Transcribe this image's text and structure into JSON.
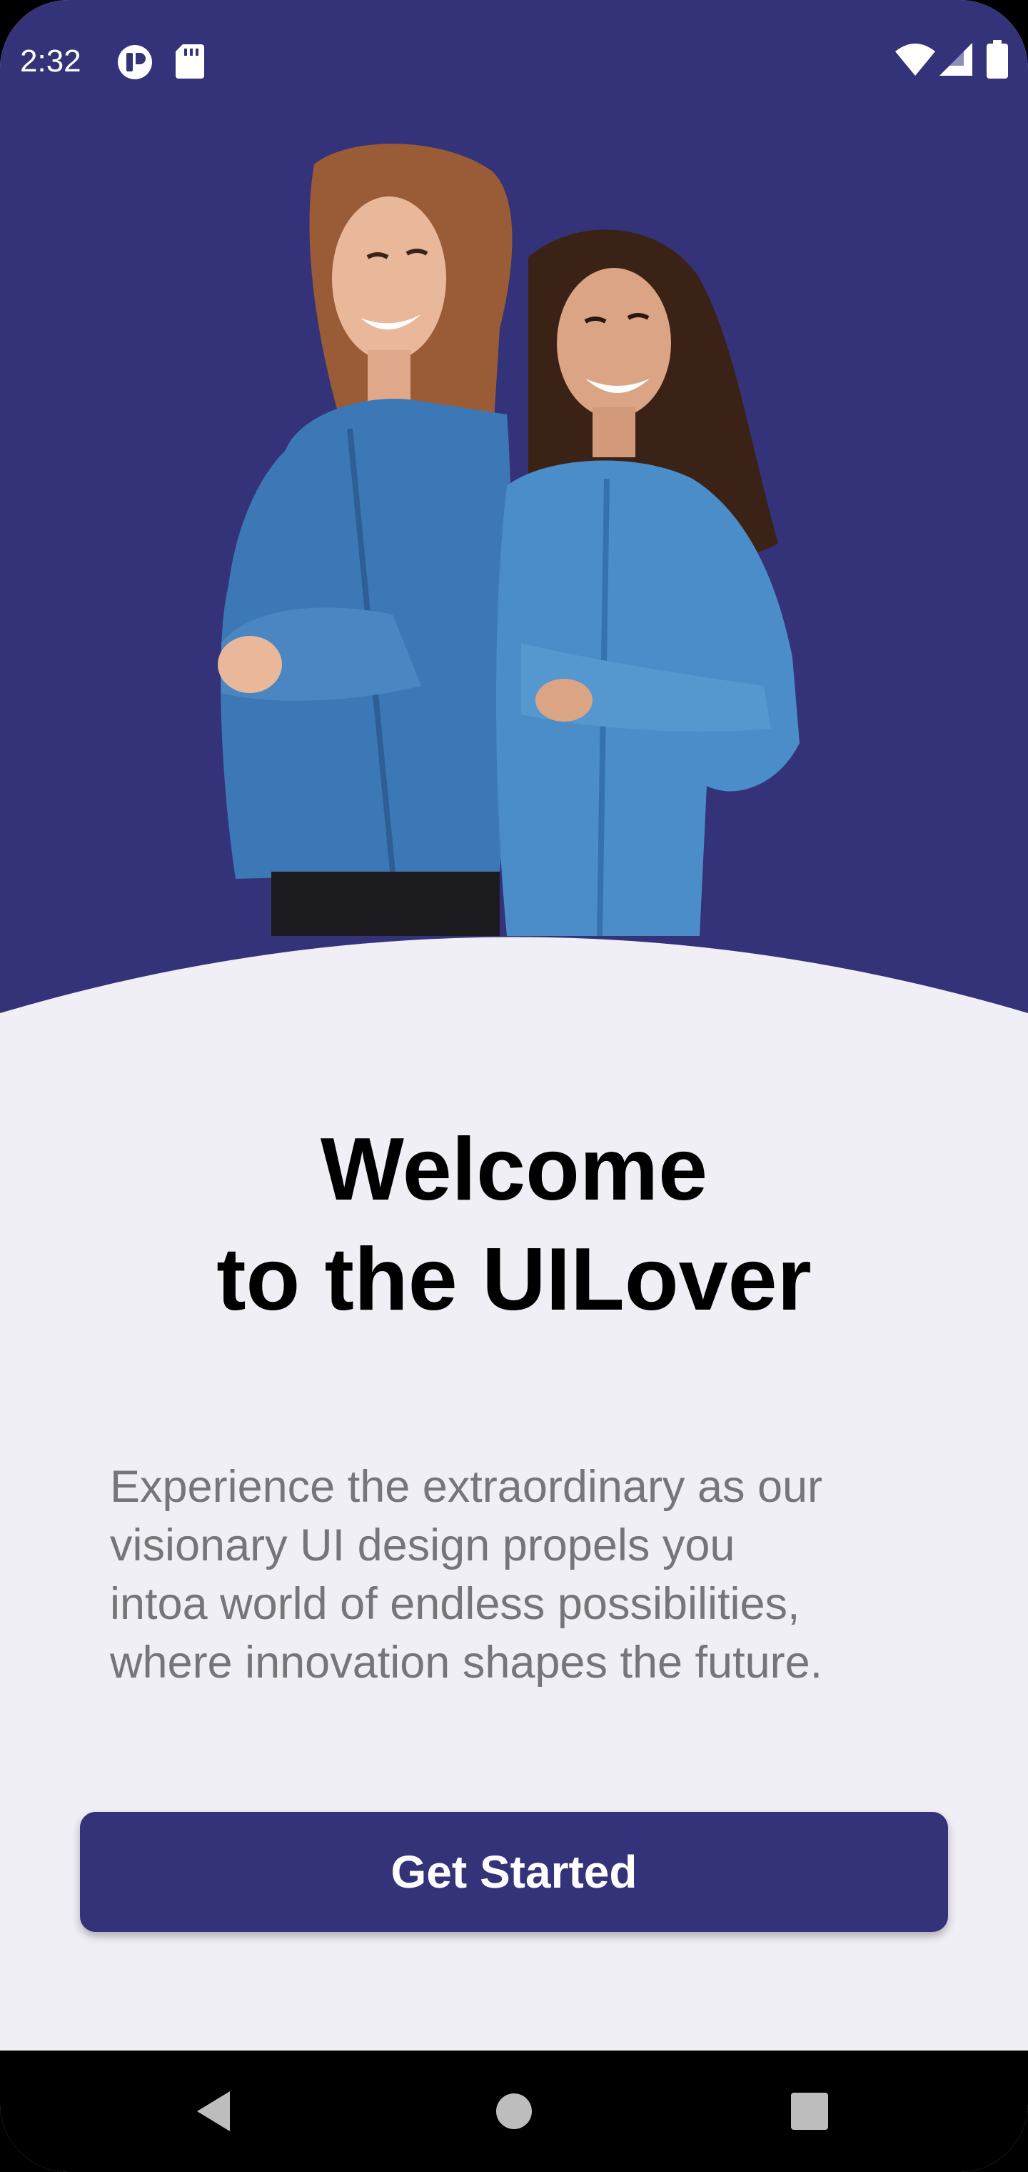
{
  "status_bar": {
    "time": "2:32",
    "left_icons": [
      "notification-badge-icon",
      "sd-card-icon"
    ],
    "right_icons": [
      "wifi-icon",
      "cellular-signal-icon",
      "battery-icon"
    ]
  },
  "colors": {
    "brand": "#343379",
    "background": "#f0eff5",
    "title": "#000000",
    "body_text": "#75757a",
    "button_text": "#ffffff"
  },
  "hero": {
    "image": "two-women-denim-shirts-back-to-back"
  },
  "welcome": {
    "title_line1": "Welcome",
    "title_line2": "to the UILover",
    "description_line1": "Experience the extraordinary as our",
    "description_line2": "visionary UI design propels you",
    "description_line3": "intoa world of endless possibilities,",
    "description_line4": "where innovation shapes the future."
  },
  "cta": {
    "label": "Get Started"
  },
  "nav_bar": {
    "icons": [
      "back-triangle-icon",
      "home-circle-icon",
      "recents-square-icon"
    ]
  }
}
